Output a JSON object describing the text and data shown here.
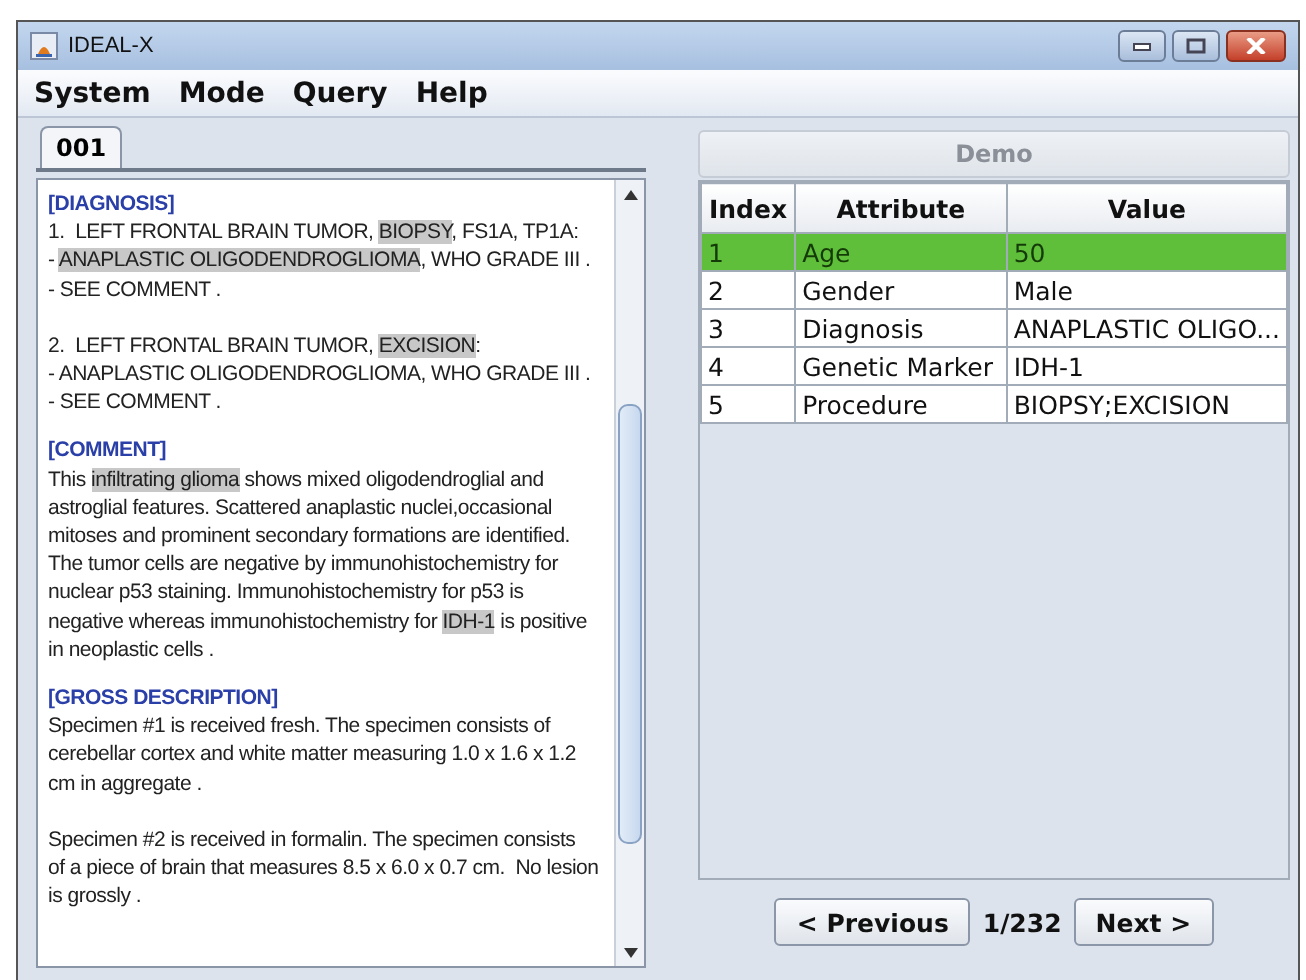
{
  "window": {
    "title": "IDEAL-X"
  },
  "menu": [
    "System",
    "Mode",
    "Query",
    "Help"
  ],
  "tabs": [
    {
      "label": "001",
      "selected": true
    }
  ],
  "report": [
    {
      "heading": "[DIAGNOSIS]",
      "paragraphs": [
        [
          [
            {
              "text": "1.  LEFT FRONTAL BRAIN TUMOR, ",
              "highlight": false
            },
            {
              "text": "BIOPSY",
              "highlight": true
            },
            {
              "text": ", FS1A, TP1A:",
              "highlight": false
            }
          ],
          [
            {
              "text": "- ",
              "highlight": false
            },
            {
              "text": "ANAPLASTIC OLIGODENDROGLIOMA",
              "highlight": true
            },
            {
              "text": ", WHO GRADE III .",
              "highlight": false
            }
          ],
          [
            {
              "text": "- SEE COMMENT .",
              "highlight": false
            }
          ]
        ],
        [
          [
            {
              "text": "2.  LEFT FRONTAL BRAIN TUMOR, ",
              "highlight": false
            },
            {
              "text": "EXCISION",
              "highlight": true
            },
            {
              "text": ":",
              "highlight": false
            }
          ],
          [
            {
              "text": "- ANAPLASTIC OLIGODENDROGLIOMA, WHO GRADE III .",
              "highlight": false
            }
          ],
          [
            {
              "text": "- SEE COMMENT .",
              "highlight": false
            }
          ]
        ]
      ]
    },
    {
      "heading": "[COMMENT]",
      "paragraphs": [
        [
          [
            {
              "text": "This ",
              "highlight": false
            },
            {
              "text": "infiltrating glioma",
              "highlight": true
            },
            {
              "text": " shows mixed oligodendroglial and",
              "highlight": false
            }
          ],
          [
            {
              "text": "astroglial features. Scattered anaplastic nuclei,occasional",
              "highlight": false
            }
          ],
          [
            {
              "text": "mitoses and prominent secondary formations are identified.",
              "highlight": false
            }
          ],
          [
            {
              "text": "The tumor cells are negative by immunohistochemistry for",
              "highlight": false
            }
          ],
          [
            {
              "text": "nuclear p53 staining. Immunohistochemistry for p53 is",
              "highlight": false
            }
          ],
          [
            {
              "text": "negative whereas immunohistochemistry for ",
              "highlight": false
            },
            {
              "text": "IDH-1",
              "highlight": true
            },
            {
              "text": " is positive",
              "highlight": false
            }
          ],
          [
            {
              "text": "in neoplastic cells .",
              "highlight": false
            }
          ]
        ]
      ]
    },
    {
      "heading": "[GROSS DESCRIPTION]",
      "paragraphs": [
        [
          [
            {
              "text": "Specimen #1 is received fresh. The specimen consists of",
              "highlight": false
            }
          ],
          [
            {
              "text": "cerebellar cortex and white matter measuring 1.0 x 1.6 x 1.2",
              "highlight": false
            }
          ],
          [
            {
              "text": "cm in aggregate .",
              "highlight": false
            }
          ]
        ],
        [
          [
            {
              "text": "Specimen #2 is received in formalin. The specimen consists",
              "highlight": false
            }
          ],
          [
            {
              "text": "of a piece of brain that measures 8.5 x 6.0 x 0.7 cm.  No lesion",
              "highlight": false
            }
          ],
          [
            {
              "text": "is grossly .",
              "highlight": false
            }
          ]
        ]
      ]
    }
  ],
  "panel": {
    "title": "Demo",
    "disabled": true
  },
  "table": {
    "columns": [
      "Index",
      "Attribute",
      "Value"
    ],
    "rows": [
      {
        "index": "1",
        "attribute": "Age",
        "value": "50",
        "selected": true
      },
      {
        "index": "2",
        "attribute": "Gender",
        "value": "Male",
        "selected": false
      },
      {
        "index": "3",
        "attribute": "Diagnosis",
        "value": "ANAPLASTIC OLIGO...",
        "selected": false
      },
      {
        "index": "4",
        "attribute": "Genetic Marker",
        "value": "IDH-1",
        "selected": false
      },
      {
        "index": "5",
        "attribute": "Procedure",
        "value": "BIOPSY;EXCISION",
        "selected": false
      }
    ]
  },
  "pager": {
    "previous": "< Previous",
    "page": "1/232",
    "next": "Next >"
  }
}
